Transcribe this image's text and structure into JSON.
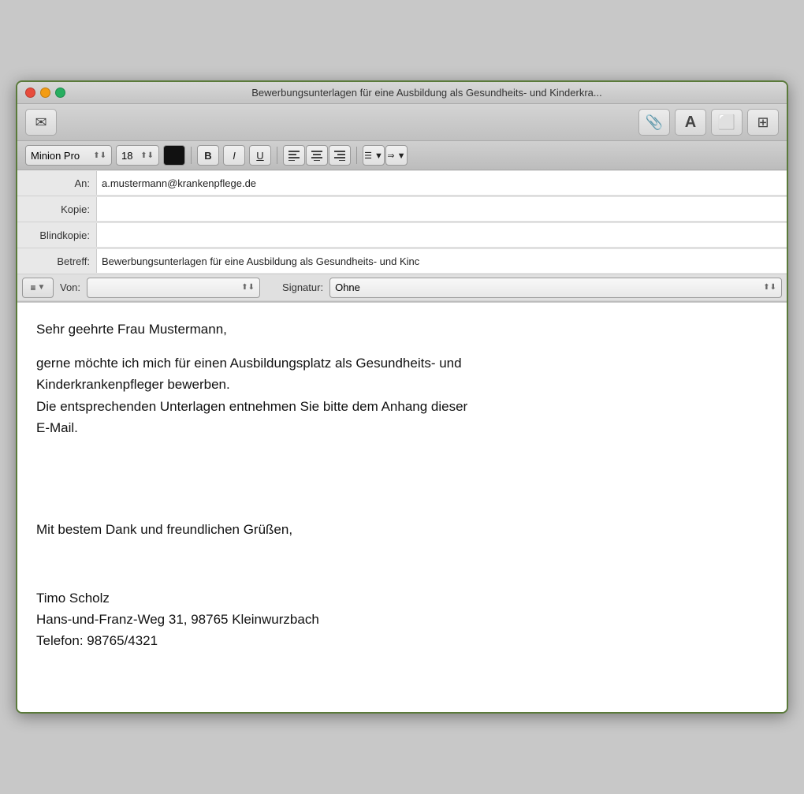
{
  "window": {
    "title": "Bewerbungsunterlagen für eine Ausbildung als Gesundheits- und Kinderkra..."
  },
  "toolbar": {
    "send_label": "✈",
    "attach_label": "📎",
    "font_label": "A",
    "photo_label": "🖼",
    "more_label": "⊞"
  },
  "formatbar": {
    "font_name": "Minion Pro",
    "font_size": "18",
    "bold_label": "B",
    "italic_label": "I",
    "underline_label": "U",
    "align_left": "≡",
    "align_center": "≡",
    "align_right": "≡",
    "list_label": "☰",
    "indent_label": "⇒"
  },
  "fields": {
    "to_label": "An:",
    "to_value": "a.mustermann@krankenpflege.de",
    "cc_label": "Kopie:",
    "cc_value": "",
    "bcc_label": "Blindkopie:",
    "bcc_value": "",
    "subject_label": "Betreff:",
    "subject_value": "Bewerbungsunterlagen für eine Ausbildung als Gesundheits- und Kinc",
    "from_label": "Von:",
    "from_value": "",
    "signature_label": "Signatur:",
    "signature_value": "Ohne"
  },
  "body": {
    "line1": "Sehr geehrte Frau Mustermann,",
    "line2": "",
    "line3": "gerne möchte ich mich für einen Ausbildungsplatz als Gesundheits- und",
    "line4": "Kinderkrankenpfleger bewerben.",
    "line5": "Die entsprechenden Unterlagen entnehmen Sie bitte dem Anhang dieser",
    "line6": "E-Mail.",
    "line7": "",
    "line8": "",
    "line9": "",
    "line10": "",
    "line11": "Mit bestem Dank und freundlichen Grüßen,",
    "line12": "",
    "line13": "Timo Scholz",
    "line14": "Hans-und-Franz-Weg 31, 98765 Kleinwurzbach",
    "line15": "Telefon: 98765/4321"
  }
}
